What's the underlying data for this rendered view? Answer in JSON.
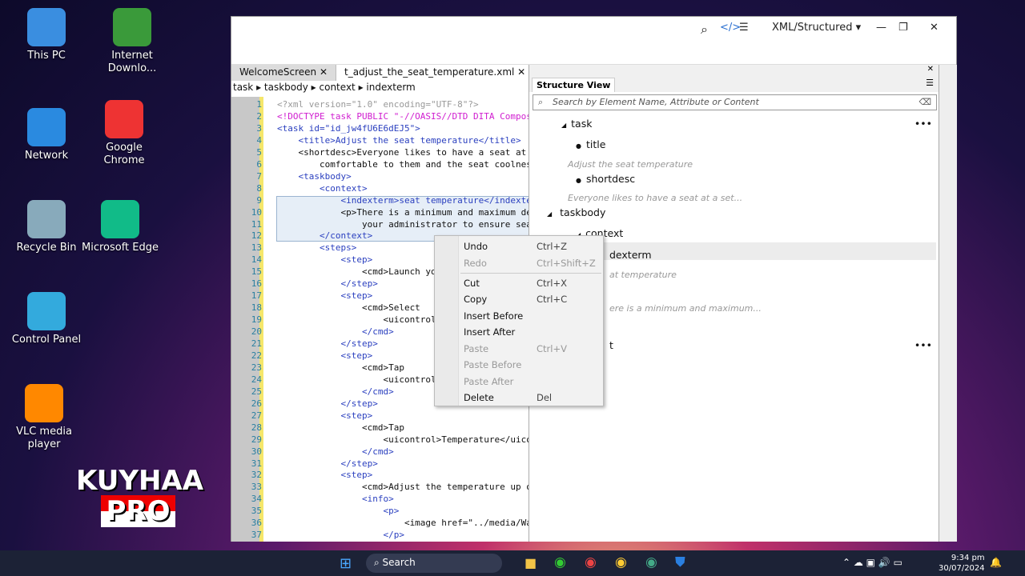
{
  "desktop": {
    "icons": [
      "This PC",
      "Internet Downlo...",
      "Network",
      "Google Chrome",
      "Recycle Bin",
      "Microsoft Edge",
      "Control Panel",
      "VLC media player"
    ],
    "watermark": "KUYHAA PRO"
  },
  "window": {
    "view_mode": "XML/Structured",
    "tabs": [
      "WelcomeScreen",
      "t_adjust_the_seat_temperature.xml"
    ],
    "breadcrumb": [
      "task",
      "taskbody",
      "context",
      "indexterm"
    ]
  },
  "editor": {
    "lines": [
      "<?xml version=\"1.0\" encoding=\"UTF-8\"?>",
      "<!DOCTYPE task PUBLIC \"-//OASIS//DTD DITA Composite",
      "<task id=\"id_jw4fU6E6dEJ5\">",
      "    <title>Adjust the seat temperature</title>",
      "    <shortdesc>Everyone likes to have a seat at a s",
      "        comfortable to them and the seat coolness o",
      "    <taskbody>",
      "        <context>",
      "            <indexterm>seat temperature</indexterm>",
      "            <p>There is a minimum and maximum defin",
      "                your administrator to ensure seats ",
      "        </context>",
      "        <steps>",
      "            <step>",
      "                <cmd>Launch your",
      "            </step>",
      "            <step>",
      "                <cmd>Select",
      "                    <uicontrol>S",
      "                </cmd>",
      "            </step>",
      "            <step>",
      "                <cmd>Tap",
      "                    <uicontrol>L",
      "                </cmd>",
      "            </step>",
      "            <step>",
      "                <cmd>Tap",
      "                    <uicontrol>Temperature</uicontr",
      "                </cmd>",
      "            </step>",
      "            <step>",
      "                <cmd>Adjust the temperature up or d",
      "                <info>",
      "                    <p>",
      "                        <image href=\"../media/WarmC",
      "                    </p>"
    ]
  },
  "structure": {
    "title": "Structure View",
    "search_placeholder": "Search by Element Name, Attribute or Content",
    "nodes": [
      {
        "label": "task"
      },
      {
        "label": "title",
        "desc": "Adjust the seat temperature"
      },
      {
        "label": "shortdesc",
        "desc": "Everyone likes to have a seat at a set..."
      },
      {
        "label": "taskbody"
      },
      {
        "label": "context"
      },
      {
        "label": "dexterm",
        "desc": "at temperature"
      },
      {
        "label": "",
        "desc": "ere is a minimum and maximum..."
      },
      {
        "label": "t"
      }
    ]
  },
  "context_menu": [
    {
      "label": "Undo",
      "shortcut": "Ctrl+Z",
      "enabled": true
    },
    {
      "label": "Redo",
      "shortcut": "Ctrl+Shift+Z",
      "enabled": false
    },
    {
      "label": "Cut",
      "shortcut": "Ctrl+X",
      "enabled": true
    },
    {
      "label": "Copy",
      "shortcut": "Ctrl+C",
      "enabled": true
    },
    {
      "label": "Insert Before",
      "shortcut": "",
      "enabled": true
    },
    {
      "label": "Insert After",
      "shortcut": "",
      "enabled": true
    },
    {
      "label": "Paste",
      "shortcut": "Ctrl+V",
      "enabled": false
    },
    {
      "label": "Paste Before",
      "shortcut": "",
      "enabled": false
    },
    {
      "label": "Paste After",
      "shortcut": "",
      "enabled": false
    },
    {
      "label": "Delete",
      "shortcut": "Del",
      "enabled": true
    }
  ],
  "taskbar": {
    "search": "Search",
    "time": "9:34 pm",
    "date": "30/07/2024"
  }
}
